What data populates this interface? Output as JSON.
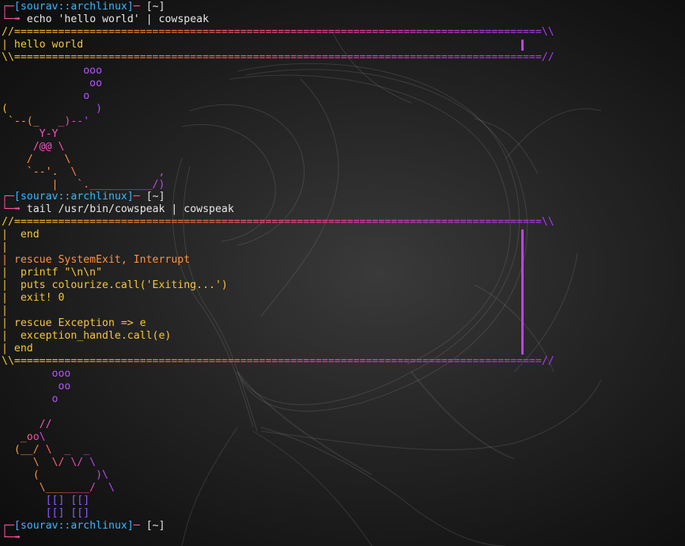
{
  "prompt": {
    "user": "sourav",
    "sep": "::",
    "host": "archlinux",
    "dir": "[~]"
  },
  "session1": {
    "command": "echo 'hello world' | cowspeak",
    "bubble_top": "//====================================================================================\\\\",
    "bubble_line": "| hello world",
    "bubble_bottom": "\\\\====================================================================================//",
    "art": [
      "             ooo",
      "              oo",
      "             o",
      "(              )",
      " `--(_   _)--'",
      "      Y-Y",
      "     /@@ \\",
      "    /     \\",
      "    `--'.  \\             ,",
      "        |   `.__________/)"
    ]
  },
  "session2": {
    "command": "tail /usr/bin/cowspeak | cowspeak",
    "bubble_top": "//====================================================================================\\\\",
    "lines": [
      "|  end",
      "|",
      "| rescue SystemExit, Interrupt",
      "|  printf \"\\n\\n\"",
      "|  puts colourize.call('Exiting...')",
      "|  exit! 0",
      "|",
      "| rescue Exception => e",
      "|  exception_handle.call(e)",
      "| end"
    ],
    "bubble_bottom": "\\\\====================================================================================//",
    "art": [
      "        ooo",
      "         oo",
      "        o",
      "",
      "      //",
      "   _oo\\",
      "  (__/ \\  _  _",
      "     \\  \\/ \\/ \\",
      "     (         )\\",
      "      \\_______/  \\",
      "       [[] [[]",
      "       [[] [[]"
    ]
  },
  "prompt_arrow": "➡"
}
